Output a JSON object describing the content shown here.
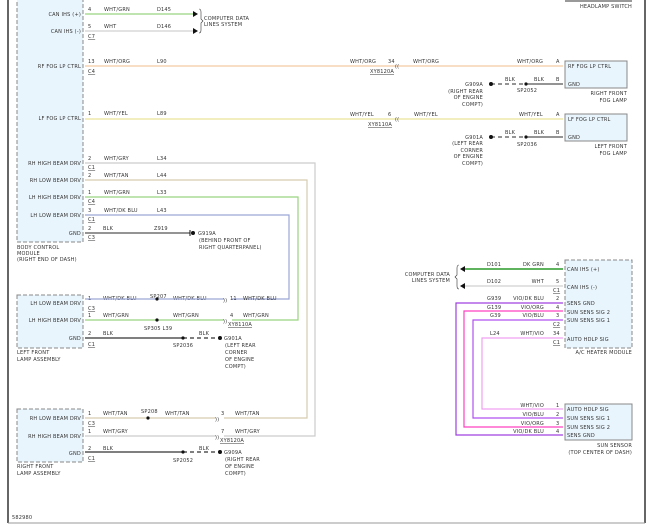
{
  "diagram_id": "582980",
  "colors": {
    "wht_grn": "#9bd37f",
    "wht": "#d0d0d0",
    "wht_org": "#f3c9a0",
    "wht_yel": "#ece39a",
    "wht_gry": "#cccccc",
    "wht_tan": "#d6ccb0",
    "wht_dk_blu": "#9aa6d8",
    "blk": "#555555",
    "dk_grn": "#2a9a2a",
    "vio_dk_blu": "#a040e0",
    "vio_org": "#ff40c0",
    "vio_blu": "#b050f0",
    "wht_vio": "#f0a0f0"
  },
  "headlamp_switch": {
    "label": "HEADLAMP SWITCH"
  },
  "bcm": {
    "name": "BODY CONTROL",
    "name2": "MODULE",
    "location": "(RIGHT END OF DASH)",
    "pins": [
      "CAN IHS (+)",
      "CAN IHS (-)",
      "RF FOG LP CTRL",
      "LF FOG LP CTRL",
      "RH HIGH BEAM DRV",
      "RH LOW BEAM DRV",
      "LH HIGH BEAM DRV",
      "LH LOW BEAM DRV",
      "GND"
    ],
    "pin_numbers": [
      "4",
      "5",
      "13",
      "1",
      "2",
      "2",
      "1",
      "3",
      "2"
    ],
    "wire_colors": [
      "WHT/GRN",
      "WHT",
      "WHT/ORG",
      "WHT/YEL",
      "WHT/GRY",
      "WHT/TAN",
      "WHT/GRN",
      "WHT/DK BLU",
      "BLK"
    ],
    "circuits": [
      "D145",
      "D146",
      "L90",
      "L89",
      "L34",
      "L44",
      "L33",
      "L43",
      "Z919"
    ],
    "connectors": [
      "C7",
      "C4",
      "C1",
      "C4",
      "C1",
      "C3"
    ]
  },
  "computer_data_lines": {
    "line1": "COMPUTER DATA",
    "line2": "LINES SYSTEM"
  },
  "ground_g919a": {
    "id": "G919A",
    "line1": "(BEHIND FRONT OF",
    "line2": "RIGHT QUARTERPANEL)"
  },
  "rf_fog": {
    "wire_color": "WHT/ORG",
    "inline_pin": "34",
    "inline_connector": "XY8120A",
    "lamp_pins": [
      "A",
      "B"
    ],
    "gnd_wire": "BLK",
    "splice": "SP2052",
    "ground": "G909A",
    "ground_loc": [
      "(RIGHT REAR",
      "OF ENGINE",
      "COMPT)"
    ],
    "box_pins": [
      "RF FOG LP CTRL",
      "GND"
    ],
    "name": [
      "RIGHT FRONT",
      "FOG LAMP"
    ]
  },
  "lf_fog": {
    "wire_color": "WHT/YEL",
    "inline_pin": "6",
    "inline_connector": "XY8110A",
    "lamp_pins": [
      "A",
      "B"
    ],
    "gnd_wire": "BLK",
    "splice": "SP2036",
    "ground": "G901A",
    "ground_loc": [
      "(LEFT REAR",
      "CORNER",
      "OF ENGINE",
      "COMPT)"
    ],
    "box_pins": [
      "LF FOG LP CTRL",
      "GND"
    ],
    "name": [
      "LEFT FRONT",
      "FOG LAMP"
    ]
  },
  "left_lamp": {
    "name": [
      "LEFT FRONT",
      "LAMP ASSEMBLY"
    ],
    "pins": [
      "LH LOW BEAM DRV",
      "LH HIGH BEAM DRV",
      "GND"
    ],
    "pin_numbers": [
      "1",
      "1",
      "2"
    ],
    "connectors": [
      "C3",
      "C1"
    ],
    "wire_colors": [
      "WHT/DK BLU",
      "WHT/GRN",
      "BLK"
    ],
    "splices": [
      "SP207",
      "SP305 L39",
      "SP2036"
    ],
    "inline_pins": [
      "11",
      "4"
    ],
    "inline_connector": "XY8110A",
    "ground": "G901A",
    "ground_loc": [
      "(LEFT REAR",
      "CORNER",
      "OF ENGINE",
      "COMPT)"
    ]
  },
  "right_lamp": {
    "name": [
      "RIGHT FRONT",
      "LAMP ASSEMBLY"
    ],
    "pins": [
      "RH LOW BEAM DRV",
      "RH HIGH BEAM DRV",
      "GND"
    ],
    "pin_numbers": [
      "1",
      "1",
      "2"
    ],
    "connectors": [
      "C3",
      "C1"
    ],
    "wire_colors": [
      "WHT/TAN",
      "WHT/GRY",
      "BLK"
    ],
    "splices": [
      "SP208",
      "SP2052"
    ],
    "inline_pins": [
      "3",
      "7"
    ],
    "inline_connector": "XY8120A",
    "ground": "G909A",
    "ground_loc": [
      "(RIGHT REAR",
      "OF ENGINE",
      "COMPT)"
    ]
  },
  "ac_heater": {
    "name": "A/C HEATER MODULE",
    "pins": [
      "CAN IHS (+)",
      "CAN IHS (-)",
      "SENS GND",
      "SUN SENS SIG 2",
      "SUN SENS SIG 1",
      "AUTO HDLP SIG"
    ],
    "pin_numbers": [
      "4",
      "5",
      "2",
      "4",
      "3",
      "34"
    ],
    "wire_colors": [
      "DK GRN",
      "WHT",
      "VIO/DK BLU",
      "VIO/ORG",
      "VIO/BLU",
      "WHT/VIO"
    ],
    "circuits": [
      "D101",
      "D102",
      "G939",
      "G139",
      "G39",
      "L24"
    ],
    "connectors": [
      "C1",
      "C2",
      "C1"
    ]
  },
  "sun_sensor": {
    "name": "SUN SENSOR",
    "location": "(TOP CENTER OF DASH)",
    "pins": [
      "AUTO HDLP SIG",
      "SUN SENS SIG 1",
      "SUN SENS SIG 2",
      "SENS GND"
    ],
    "pin_numbers": [
      "1",
      "2",
      "3",
      "4"
    ],
    "wire_colors": [
      "WHT/VIO",
      "VIO/BLU",
      "VIO/ORG",
      "VIO/DK BLU"
    ]
  }
}
